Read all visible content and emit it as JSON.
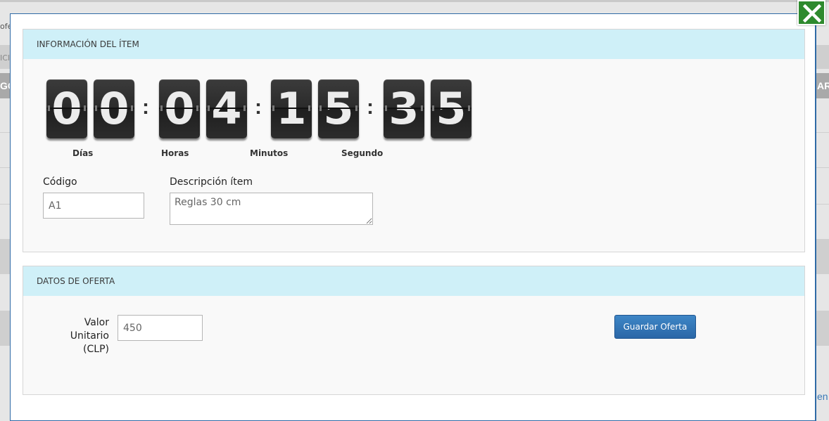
{
  "background": {
    "fragments": [
      "ofe",
      "ICI",
      "GO",
      "AR",
      "en"
    ]
  },
  "close_button": {
    "icon": "close-icon",
    "color": "#2e8a2e"
  },
  "item_panel": {
    "title": "INFORMACIÓN DEL ÍTEM",
    "countdown": {
      "digits": [
        "0",
        "0",
        "0",
        "4",
        "1",
        "5",
        "3",
        "5"
      ],
      "separator": ":",
      "labels": {
        "days": "Días",
        "hours": "Horas",
        "minutes": "Minutos",
        "seconds": "Segundo"
      }
    },
    "code": {
      "label": "Código",
      "value": "A1"
    },
    "description": {
      "label": "Descripción ítem",
      "value": "Reglas 30 cm"
    }
  },
  "offer_panel": {
    "title": "DATOS DE OFERTA",
    "unit_value": {
      "label_line1": "Valor Unitario",
      "label_line2": "(CLP)",
      "value": "450"
    },
    "save_label": "Guardar Oferta"
  },
  "colors": {
    "panel_header": "#cff0f8",
    "accent_button": "#2a67a7",
    "modal_border": "#2f6aa6"
  }
}
